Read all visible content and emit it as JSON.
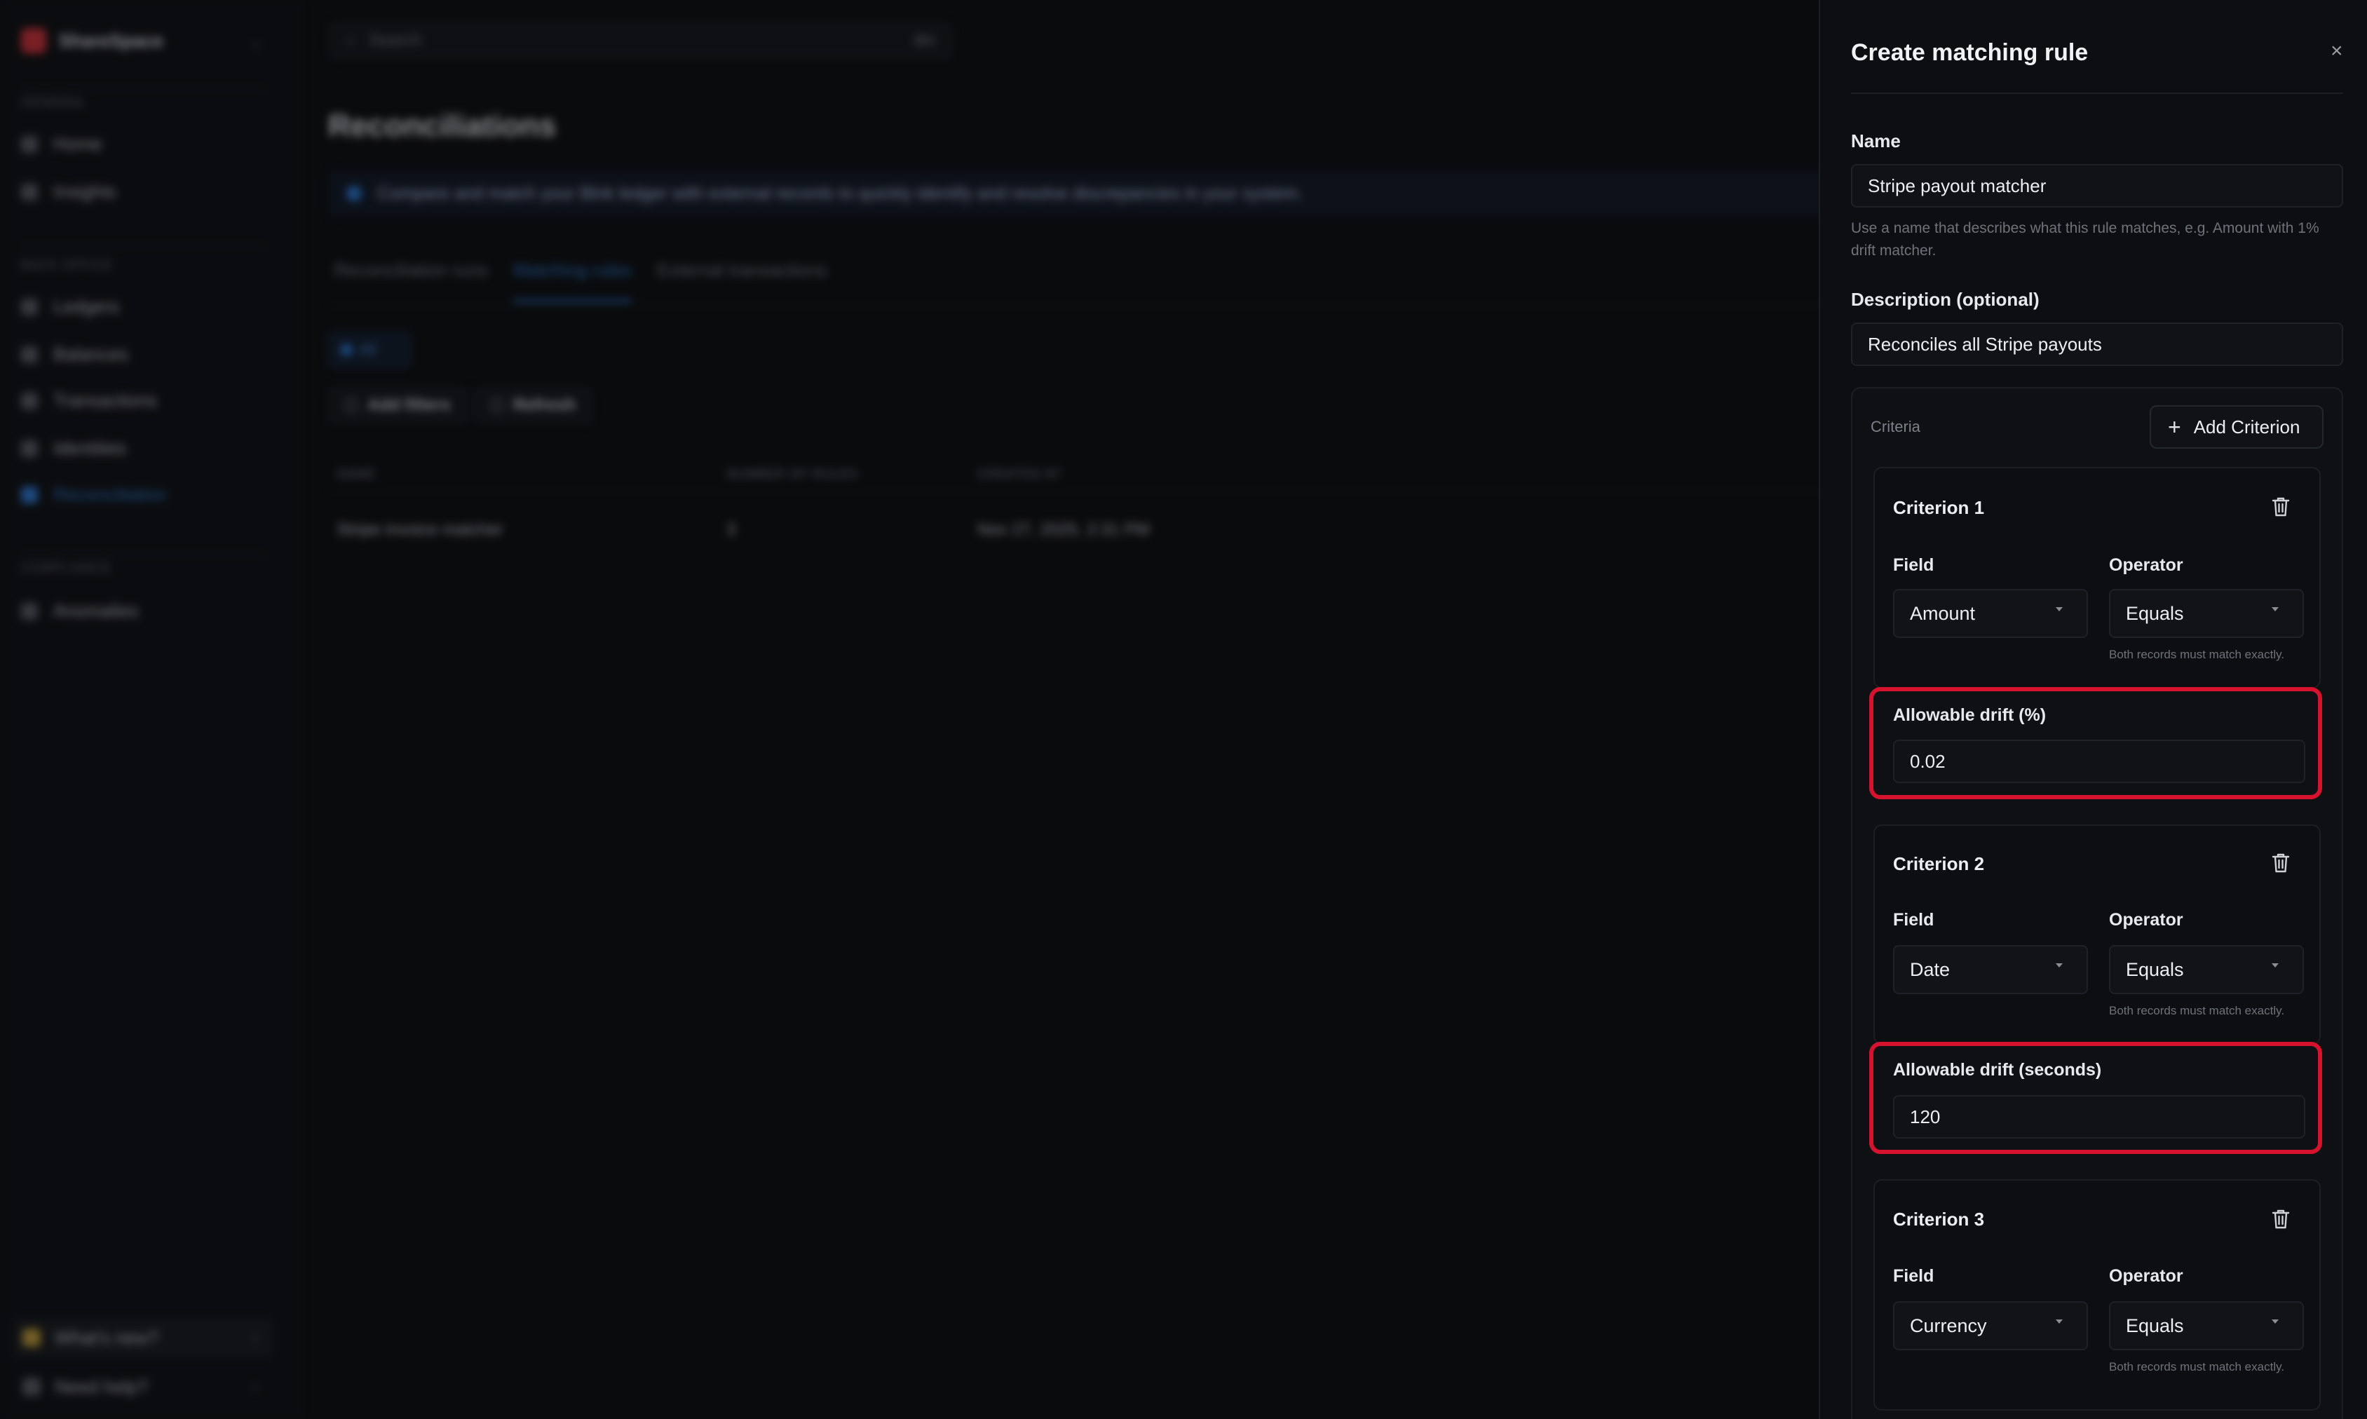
{
  "app": {
    "brand": "ShareSpace",
    "sidebar": {
      "sections": [
        "GENERAL",
        "BACK OFFICE",
        "COMPLIANCE"
      ],
      "items": [
        {
          "label": "Home"
        },
        {
          "label": "Insights"
        },
        {
          "label": "Ledgers"
        },
        {
          "label": "Balances"
        },
        {
          "label": "Transactions"
        },
        {
          "label": "Identities"
        },
        {
          "label": "Reconciliation"
        },
        {
          "label": "Anomalies"
        }
      ],
      "whats_new": "What's new?",
      "need_help": "Need help?"
    },
    "search": {
      "placeholder": "Search",
      "shortcut": "⌘K"
    },
    "page_title": "Reconciliations",
    "banner": "Compare and match your Blnk ledger with external records to quickly identify and resolve discrepancies in your system.",
    "tabs": [
      "Reconciliation runs",
      "Matching rules",
      "External transactions"
    ],
    "filter_chip": "All",
    "actions": {
      "add_filters": "Add filters",
      "refresh": "Refresh"
    },
    "table": {
      "headers": [
        "NAME",
        "NUMBER OF RULES",
        "CREATED AT"
      ],
      "rows": [
        [
          "Stripe invoice matcher",
          "3",
          "Nov 27, 2025, 2:31 PM"
        ]
      ]
    }
  },
  "drawer": {
    "title": "Create matching rule",
    "close_icon": "×",
    "name_label": "Name",
    "name_value": "Stripe payout matcher",
    "name_hint": "Use a name that describes what this rule matches, e.g. Amount with 1% drift matcher.",
    "description_label": "Description (optional)",
    "description_value": "Reconciles all Stripe payouts",
    "criteria_label": "Criteria",
    "add_criterion": "Add Criterion",
    "criteria": [
      {
        "title": "Criterion 1",
        "field_label": "Field",
        "field_value": "Amount",
        "operator_label": "Operator",
        "operator_value": "Equals",
        "operator_hint": "Both records must match exactly.",
        "drift_label": "Allowable drift (%)",
        "drift_value": "0.02"
      },
      {
        "title": "Criterion 2",
        "field_label": "Field",
        "field_value": "Date",
        "operator_label": "Operator",
        "operator_value": "Equals",
        "operator_hint": "Both records must match exactly.",
        "drift_label": "Allowable drift (seconds)",
        "drift_value": "120"
      },
      {
        "title": "Criterion 3",
        "field_label": "Field",
        "field_value": "Currency",
        "operator_label": "Operator",
        "operator_value": "Equals",
        "operator_hint": "Both records must match exactly."
      }
    ],
    "highlight_color": "#d5132f"
  }
}
